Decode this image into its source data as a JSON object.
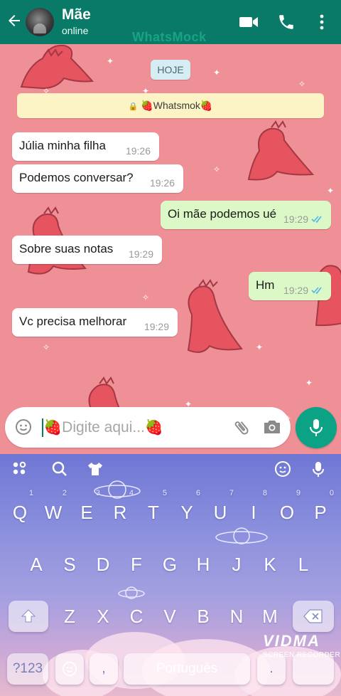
{
  "header": {
    "contact_name": "Mãe",
    "contact_status": "online",
    "watermark": "WhatsMock",
    "bg_color": "#0a7a68"
  },
  "chat": {
    "date_chip": "HOJE",
    "notice": "🍓Whatsmok🍓",
    "messages": [
      {
        "direction": "in",
        "text": "Júlia minha filha",
        "time": "19:26"
      },
      {
        "direction": "in",
        "text": "Podemos conversar?",
        "time": "19:26"
      },
      {
        "direction": "out",
        "text": "Oi mãe podemos ué",
        "time": "19:29",
        "ticks": "read"
      },
      {
        "direction": "in",
        "text": "Sobre suas notas",
        "time": "19:29"
      },
      {
        "direction": "out",
        "text": "Hm",
        "time": "19:29",
        "ticks": "read"
      },
      {
        "direction": "in",
        "text": "Vc precisa melhorar",
        "time": "19:29"
      }
    ]
  },
  "composer": {
    "placeholder": "🍓Digite aqui...🍓"
  },
  "keyboard": {
    "row1": [
      {
        "letter": "Q",
        "num": "1"
      },
      {
        "letter": "W",
        "num": "2"
      },
      {
        "letter": "E",
        "num": "3"
      },
      {
        "letter": "R",
        "num": "4"
      },
      {
        "letter": "T",
        "num": "5"
      },
      {
        "letter": "Y",
        "num": "6"
      },
      {
        "letter": "U",
        "num": "7"
      },
      {
        "letter": "I",
        "num": "8"
      },
      {
        "letter": "O",
        "num": "9"
      },
      {
        "letter": "P",
        "num": "0"
      }
    ],
    "row2": [
      "A",
      "S",
      "D",
      "F",
      "G",
      "H",
      "J",
      "K",
      "L"
    ],
    "row3": [
      "Z",
      "X",
      "C",
      "V",
      "B",
      "N",
      "M"
    ],
    "symbols_key": "?123",
    "comma_key": ",",
    "space_label": "Português",
    "period_key": "."
  },
  "overlay": {
    "logo": "VIDMA",
    "subtitle": "SCREEN RECORDER"
  },
  "colors": {
    "accent": "#0ca286",
    "incoming_bubble": "#ffffff",
    "outgoing_bubble": "#dcf8c6",
    "read_ticks": "#4fb6ec",
    "chat_bg": "#ef8f96"
  }
}
